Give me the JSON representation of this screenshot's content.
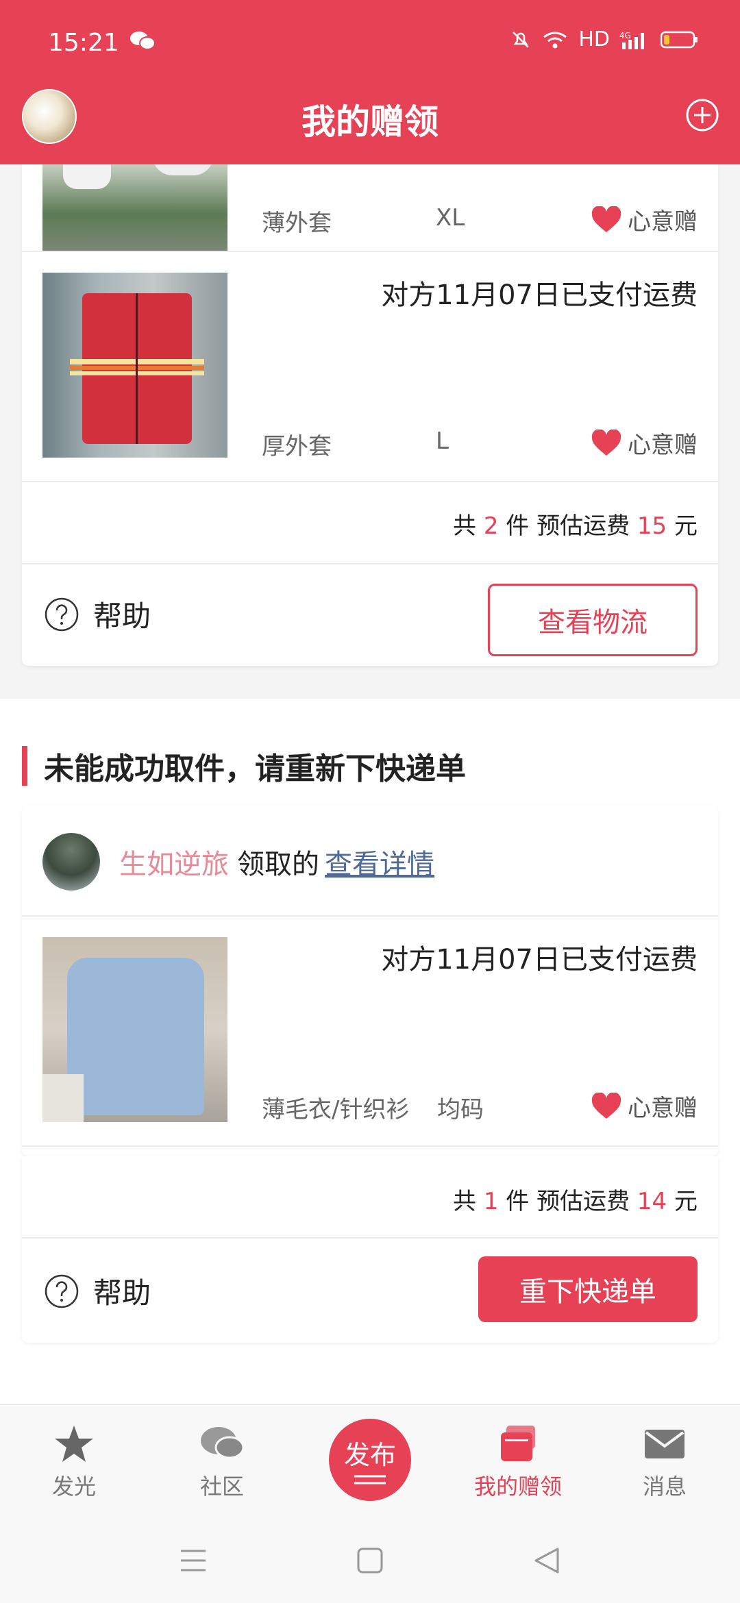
{
  "status": {
    "time": "15:21",
    "network": "HD"
  },
  "header": {
    "title": "我的赠领"
  },
  "card1": {
    "item1": {
      "category": "薄外套",
      "size": "XL",
      "tag": "心意赠"
    },
    "item2": {
      "note": "对方11月07日已支付运费",
      "category": "厚外套",
      "size": "L",
      "tag": "心意赠"
    },
    "summary": {
      "prefix": "共",
      "count": "2",
      "mid": "件 预估运费",
      "fee": "15",
      "suffix": "元"
    },
    "help": "帮助",
    "action": "查看物流"
  },
  "section": {
    "title": "未能成功取件，请重新下快递单"
  },
  "card2": {
    "receiver_name": "生如逆旅",
    "receiver_text": "领取的",
    "details_link": "查看详情",
    "item": {
      "note": "对方11月07日已支付运费",
      "category": "薄毛衣/针织衫",
      "size": "均码",
      "tag": "心意赠"
    },
    "summary": {
      "prefix": "共",
      "count": "1",
      "mid": "件 预估运费",
      "fee": "14",
      "suffix": "元"
    },
    "help": "帮助",
    "action": "重下快递单"
  },
  "tabs": {
    "t1": "发光",
    "t2": "社区",
    "publish": "发布",
    "t4": "我的赠领",
    "t5": "消息"
  },
  "colors": {
    "brand": "#e64155",
    "receiver_name": "#e88a96",
    "link": "#4f6a96"
  }
}
